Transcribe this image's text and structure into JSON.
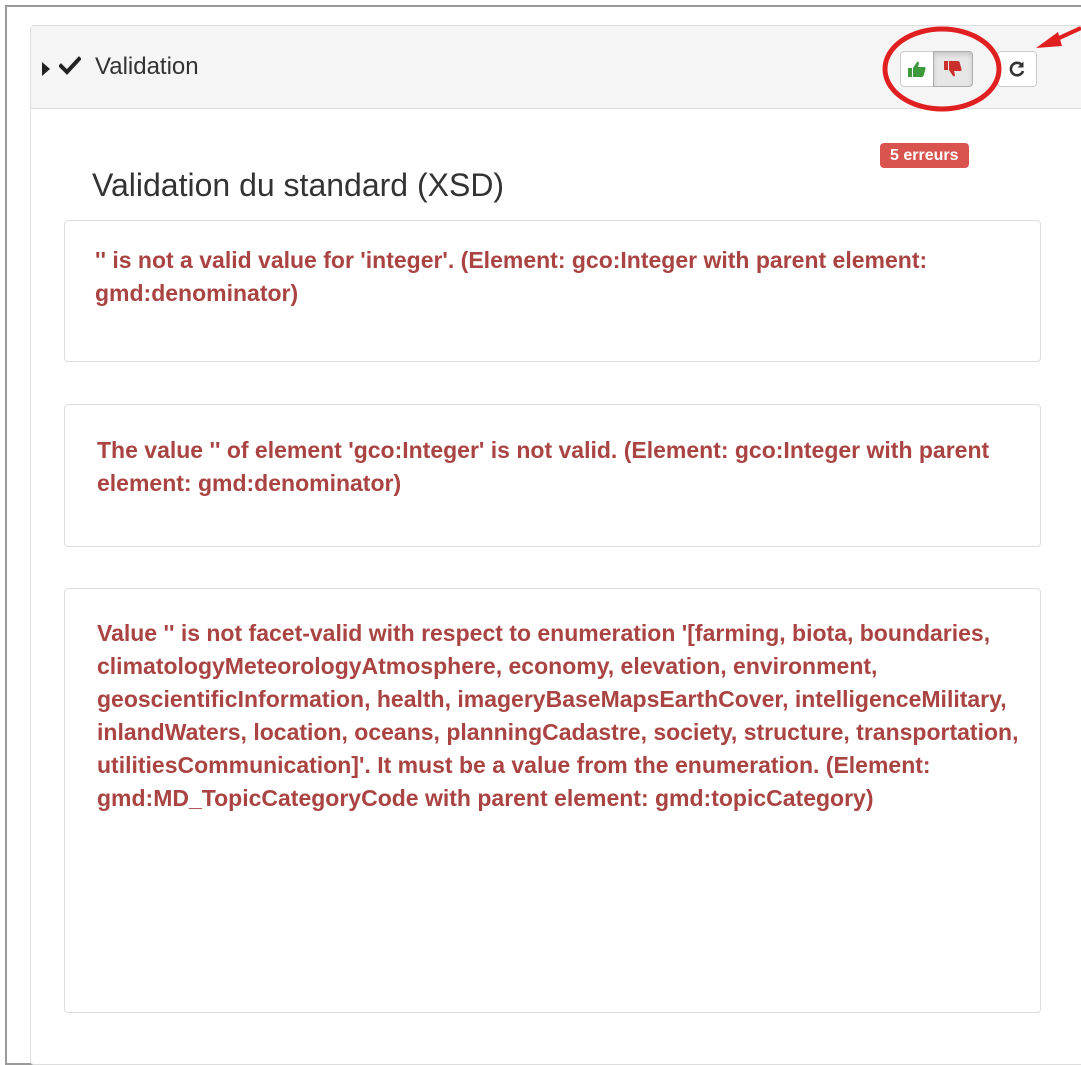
{
  "panel": {
    "title": "Validation",
    "caret_icon": "caret-right-icon",
    "status_icon": "check-icon",
    "buttons": {
      "thumbs_up_icon": "thumbs-up-icon",
      "thumbs_down_icon": "thumbs-down-icon",
      "refresh_icon": "refresh-icon"
    },
    "colors": {
      "thumbs_up": "#3c9a3c",
      "thumbs_down": "#c9302c",
      "error_text": "#a94442",
      "badge": "#d9534f",
      "annotation": "#e02020"
    }
  },
  "section": {
    "title": "Validation du standard (XSD)",
    "badge": "5 erreurs"
  },
  "errors": [
    {
      "message": "'' is not a valid value for 'integer'. (Element: gco:Integer with parent element: gmd:denominator)"
    },
    {
      "message": "The value '' of element 'gco:Integer' is not valid. (Element: gco:Integer with parent element: gmd:denominator)"
    },
    {
      "message": "Value '' is not facet-valid with respect to enumeration '[farming, biota, boundaries, climatologyMeteorologyAtmosphere, economy, elevation, environment, geoscientificInformation, health, imageryBaseMapsEarthCover, intelligenceMilitary, inlandWaters, location, oceans, planningCadastre, society, structure, transportation, utilitiesCommunication]'. It must be a value from the enumeration. (Element: gmd:MD_TopicCategoryCode with parent element: gmd:topicCategory)"
    }
  ]
}
